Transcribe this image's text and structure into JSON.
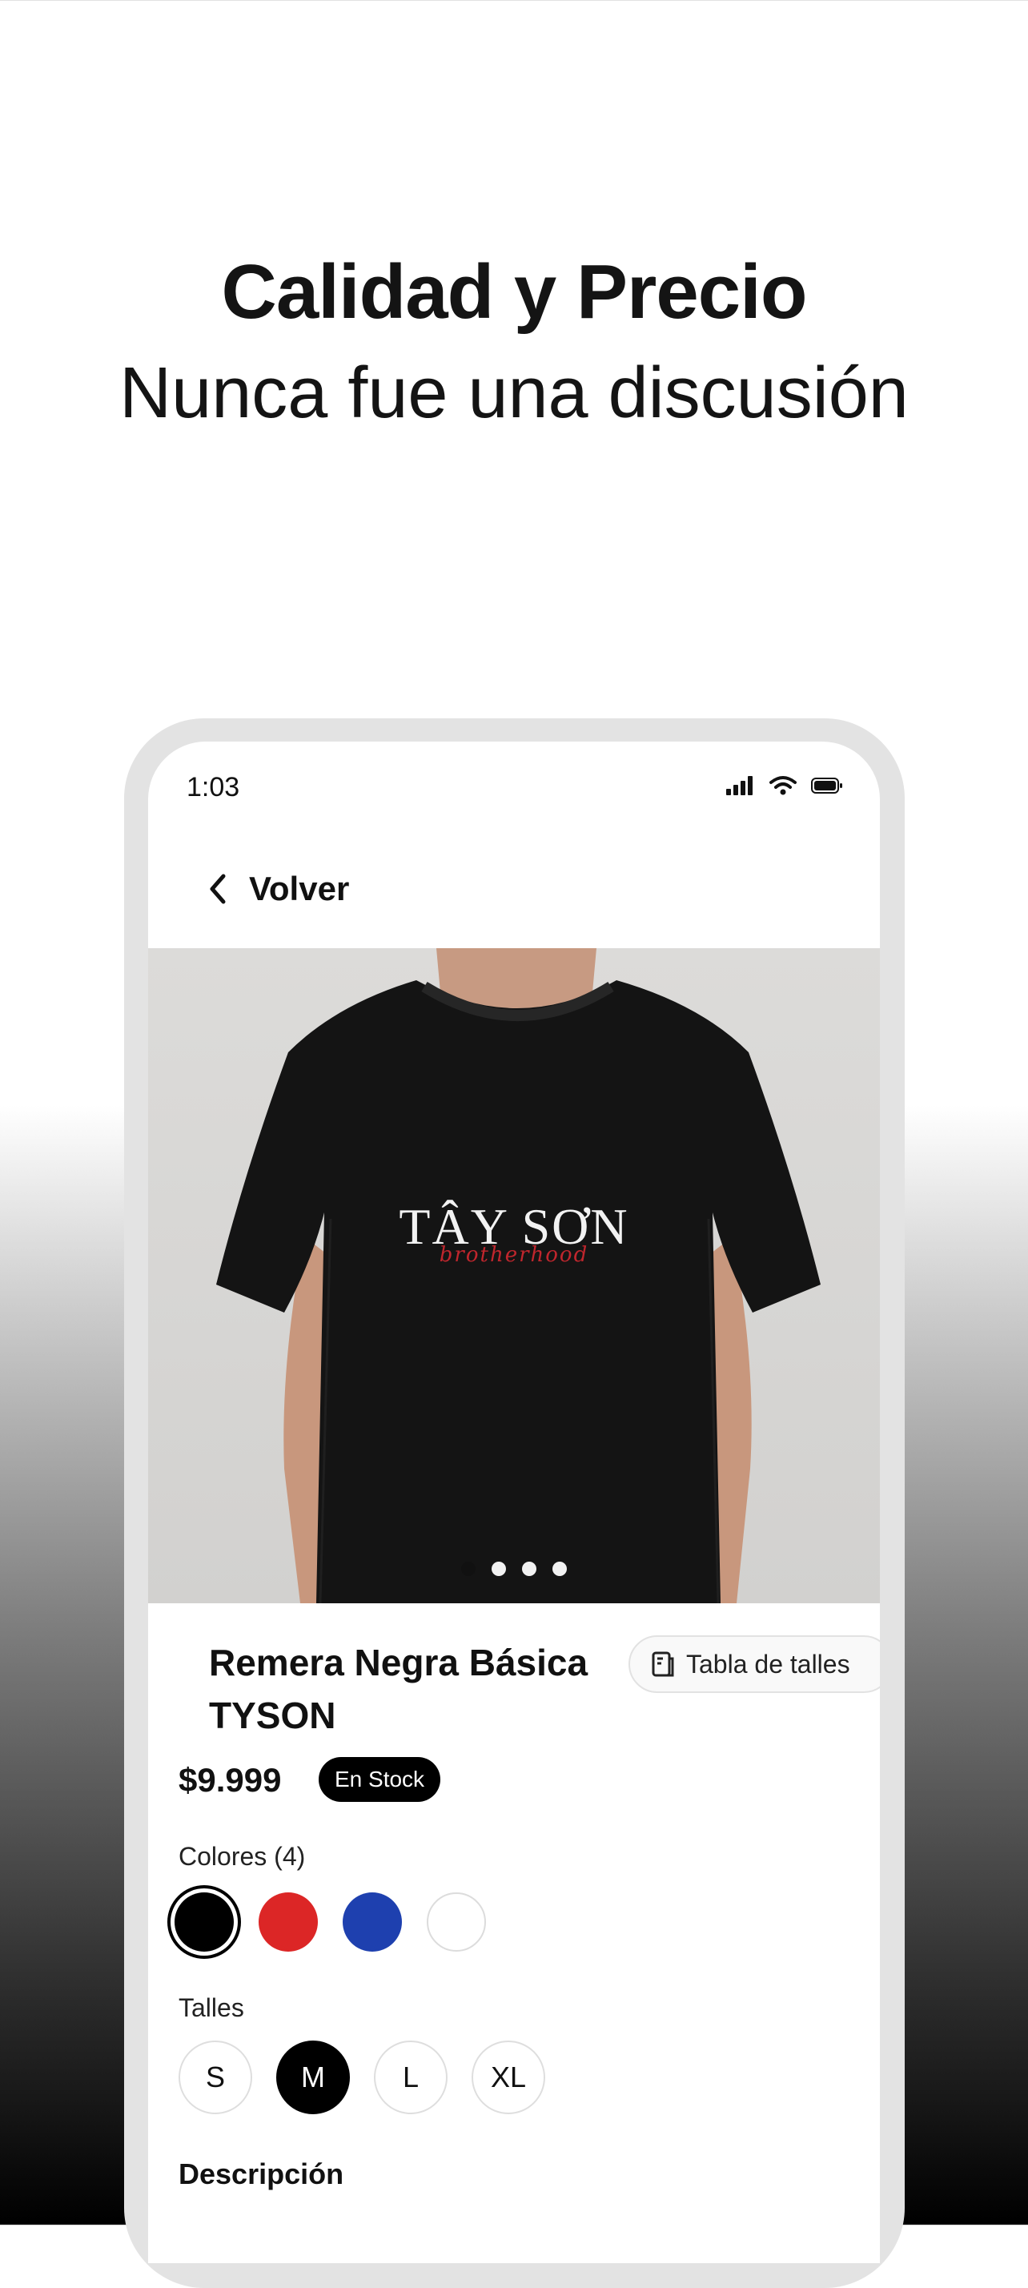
{
  "promo": {
    "headline": "Calidad y Precio",
    "subline": "Nunca fue una discusión"
  },
  "status_bar": {
    "time": "1:03",
    "icons": [
      "signal-icon",
      "wifi-icon",
      "battery-icon"
    ]
  },
  "nav": {
    "back_label": "Volver",
    "back_icon": "chevron-left-icon"
  },
  "product": {
    "image_print_text": "TÂY SƠN",
    "image_print_script": "brotherhood",
    "image_count": 4,
    "image_active_index": 0,
    "title_line1": "Remera Negra Básica",
    "title_line2": "TYSON",
    "size_chart_label": "Tabla de talles",
    "size_chart_icon": "ruler-doc-icon",
    "price": "$9.999",
    "stock_badge": "En Stock"
  },
  "colors": {
    "label": "Colores (4)",
    "options": [
      {
        "name": "black",
        "hex": "#000000",
        "selected": true
      },
      {
        "name": "red",
        "hex": "#DC2626",
        "selected": false
      },
      {
        "name": "blue",
        "hex": "#1E40AF",
        "selected": false
      },
      {
        "name": "white",
        "hex": "#FFFFFF",
        "selected": false
      }
    ]
  },
  "sizes": {
    "label": "Talles",
    "options": [
      "S",
      "M",
      "L",
      "XL"
    ],
    "selected": "M"
  },
  "description": {
    "label": "Descripción"
  },
  "theme": {
    "accent": "#000000",
    "frame": "#E3E3E3"
  }
}
